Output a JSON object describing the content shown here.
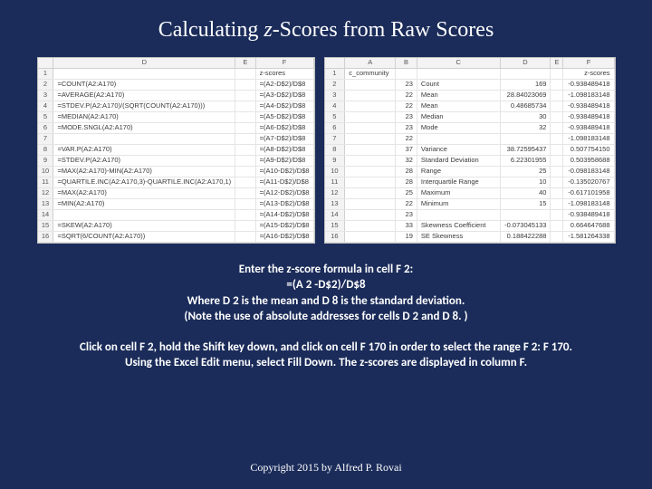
{
  "title_pre": "Calculating ",
  "title_ital": "z",
  "title_post": "-Scores from Raw Scores",
  "sheet1": {
    "cols": [
      "D",
      "E",
      "F"
    ],
    "rows": [
      [
        "1",
        "",
        "",
        "z-scores"
      ],
      [
        "2",
        "=COUNT(A2:A170)",
        "",
        "=(A2-D$2)/D$8"
      ],
      [
        "3",
        "=AVERAGE(A2:A170)",
        "",
        "=(A3-D$2)/D$8"
      ],
      [
        "4",
        "=STDEV.P(A2:A170)/(SQRT(COUNT(A2:A170)))",
        "",
        "=(A4-D$2)/D$8"
      ],
      [
        "5",
        "=MEDIAN(A2:A170)",
        "",
        "=(A5-D$2)/D$8"
      ],
      [
        "6",
        "=MODE.SNGL(A2:A170)",
        "",
        "=(A6-D$2)/D$8"
      ],
      [
        "7",
        "",
        "",
        "=(A7-D$2)/D$8"
      ],
      [
        "8",
        "=VAR.P(A2:A170)",
        "",
        "=(A8-D$2)/D$8"
      ],
      [
        "9",
        "=STDEV.P(A2:A170)",
        "",
        "=(A9-D$2)/D$8"
      ],
      [
        "10",
        "=MAX(A2:A170)-MIN(A2:A170)",
        "",
        "=(A10-D$2)/D$8"
      ],
      [
        "11",
        "=QUARTILE.INC(A2:A170,3)-QUARTILE.INC(A2:A170,1)",
        "",
        "=(A11-D$2)/D$8"
      ],
      [
        "12",
        "=MAX(A2:A170)",
        "",
        "=(A12-D$2)/D$8"
      ],
      [
        "13",
        "=MIN(A2:A170)",
        "",
        "=(A13-D$2)/D$8"
      ],
      [
        "14",
        "",
        "",
        "=(A14-D$2)/D$8"
      ],
      [
        "15",
        "=SKEW(A2:A170)",
        "",
        "=(A15-D$2)/D$8"
      ],
      [
        "16",
        "=SQRT(6/COUNT(A2:A170))",
        "",
        "=(A16-D$2)/D$8"
      ]
    ]
  },
  "sheet2": {
    "cols": [
      "A",
      "B",
      "C",
      "D",
      "E",
      "F"
    ],
    "rows": [
      [
        "1",
        "c_community",
        "",
        "",
        "",
        "",
        "z-scores"
      ],
      [
        "2",
        "",
        "23",
        "Count",
        "169",
        "",
        "-0.938489418"
      ],
      [
        "3",
        "",
        "22",
        "Mean",
        "28.84023069",
        "",
        "-1.098183148"
      ],
      [
        "4",
        "",
        "22",
        "Mean",
        "0.48685734",
        "",
        "-0.938489418"
      ],
      [
        "5",
        "",
        "23",
        "Median",
        "30",
        "",
        "-0.938489418"
      ],
      [
        "6",
        "",
        "23",
        "Mode",
        "32",
        "",
        "-0.938489418"
      ],
      [
        "7",
        "",
        "22",
        "",
        "",
        "",
        "-1.098183148"
      ],
      [
        "8",
        "",
        "37",
        "Variance",
        "38.72595437",
        "",
        "0.507754150"
      ],
      [
        "9",
        "",
        "32",
        "Standard Deviation",
        "6.22301955",
        "",
        "0.503958688"
      ],
      [
        "10",
        "",
        "28",
        "Range",
        "25",
        "",
        "-0.098183148"
      ],
      [
        "11",
        "",
        "28",
        "Interquartile Range",
        "10",
        "",
        "-0.135020767"
      ],
      [
        "12",
        "",
        "25",
        "Maximum",
        "40",
        "",
        "-0.617101958"
      ],
      [
        "13",
        "",
        "22",
        "Minimum",
        "15",
        "",
        "-1.098183148"
      ],
      [
        "14",
        "",
        "23",
        "",
        "",
        "",
        "-0.938489418"
      ],
      [
        "15",
        "",
        "33",
        "Skewness Coefficient",
        "-0.073045133",
        "",
        "0.664647688"
      ],
      [
        "16",
        "",
        "19",
        "SE Skewness",
        "0.188422288",
        "",
        "-1.581264338"
      ]
    ]
  },
  "instr": {
    "l1": "Enter the z-score formula in cell F 2:",
    "l2": "=(A 2 -D$2)/D$8",
    "l3": "Where D 2 is the mean and D 8 is the standard deviation.",
    "l4": "(Note the use of absolute addresses for cells D 2 and D 8. )"
  },
  "instr2": {
    "l1": "Click on cell F 2, hold the Shift key down, and click on cell F 170 in order to select the range F 2: F 170.",
    "l2": "Using the Excel Edit menu, select Fill Down. The z-scores are displayed in column F."
  },
  "copyright": "Copyright 2015 by Alfred P. Rovai"
}
